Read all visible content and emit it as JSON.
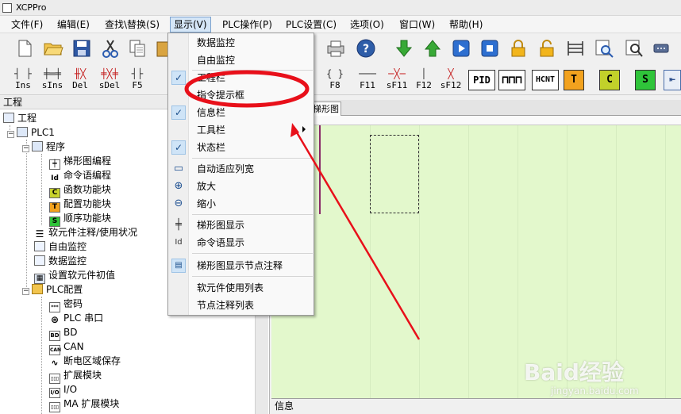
{
  "window": {
    "title": "XCPPro"
  },
  "menubar": {
    "items": [
      {
        "label": "文件(F)"
      },
      {
        "label": "编辑(E)"
      },
      {
        "label": "查找\\替换(S)"
      },
      {
        "label": "显示(V)"
      },
      {
        "label": "PLC操作(P)"
      },
      {
        "label": "PLC设置(C)"
      },
      {
        "label": "选项(O)"
      },
      {
        "label": "窗口(W)"
      },
      {
        "label": "帮助(H)"
      }
    ]
  },
  "ladder_toolbar": {
    "buttons": [
      {
        "label": "Ins"
      },
      {
        "label": "sIns"
      },
      {
        "label": "Del"
      },
      {
        "label": "sDel"
      },
      {
        "label": "F5"
      },
      {
        "label": "F8"
      },
      {
        "label": "F11"
      },
      {
        "label": "sF11"
      },
      {
        "label": "F12"
      },
      {
        "label": "sF12"
      }
    ],
    "box_buttons": [
      {
        "label": "PID"
      },
      {
        "label": "HCNT"
      },
      {
        "label": "T"
      },
      {
        "label": "C"
      },
      {
        "label": "S"
      }
    ]
  },
  "project_panel": {
    "title": "工程",
    "tree": [
      {
        "label": "工程"
      },
      {
        "label": "PLC1"
      },
      {
        "label": "程序"
      },
      {
        "label": "梯形图编程"
      },
      {
        "label": "命令语编程"
      },
      {
        "label": "函数功能块"
      },
      {
        "label": "配置功能块"
      },
      {
        "label": "顺序功能块"
      },
      {
        "label": "软元件注释/使用状况"
      },
      {
        "label": "自由监控"
      },
      {
        "label": "数据监控"
      },
      {
        "label": "设置软元件初值"
      },
      {
        "label": "PLC配置"
      },
      {
        "label": "密码"
      },
      {
        "label": "PLC 串口"
      },
      {
        "label": "BD"
      },
      {
        "label": "CAN"
      },
      {
        "label": "断电区域保存"
      },
      {
        "label": "扩展模块"
      },
      {
        "label": "I/O"
      },
      {
        "label": "MA 扩展模块"
      }
    ]
  },
  "editor": {
    "tab_label": "梯形图"
  },
  "info_panel": {
    "title": "信息"
  },
  "view_menu": {
    "items": [
      {
        "label": "数据监控"
      },
      {
        "label": "自由监控"
      },
      {
        "label": "工程栏"
      },
      {
        "label": "指令提示框"
      },
      {
        "label": "信息栏"
      },
      {
        "label": "工具栏"
      },
      {
        "label": "状态栏"
      },
      {
        "label": "自动适应列宽"
      },
      {
        "label": "放大"
      },
      {
        "label": "缩小"
      },
      {
        "label": "梯形图显示"
      },
      {
        "label": "命令语显示"
      },
      {
        "label": "梯形图显示节点注释"
      },
      {
        "label": "软元件使用列表"
      },
      {
        "label": "节点注释列表"
      }
    ],
    "checked": [
      "工程栏",
      "信息栏",
      "状态栏"
    ]
  },
  "annotation": {
    "highlight_color": "#e8101a"
  },
  "watermark": {
    "text": "Baid经验",
    "subtext": "jingyan.baidu.com"
  }
}
